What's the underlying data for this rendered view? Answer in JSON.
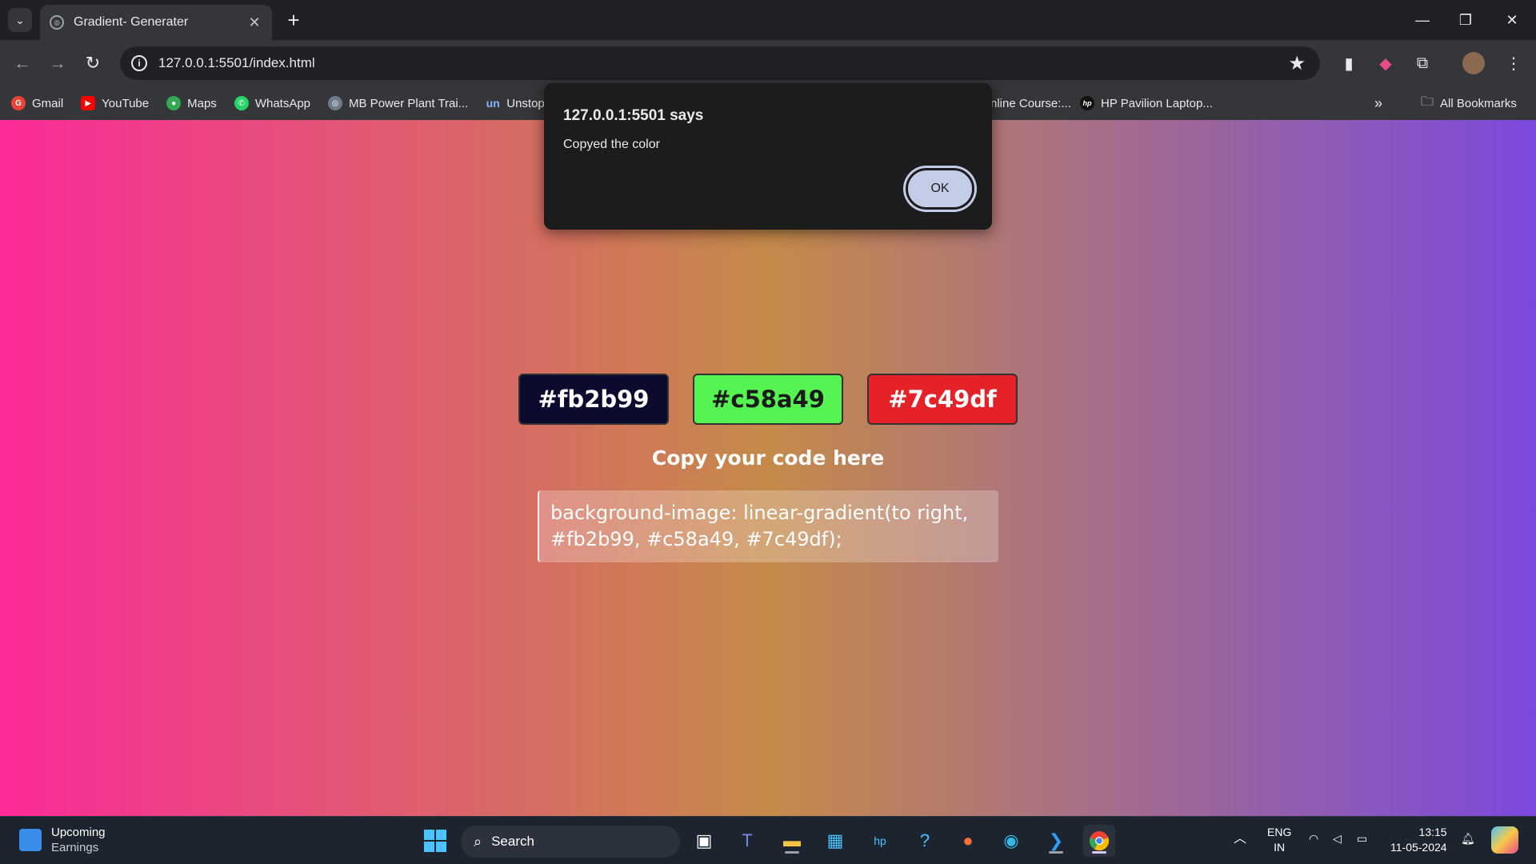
{
  "browser": {
    "tab_title": "Gradient- Generater",
    "url": "127.0.0.1:5501/index.html",
    "bookmarks": [
      {
        "label": "Gmail",
        "color": "#ea4335",
        "glyph": "G"
      },
      {
        "label": "YouTube",
        "color": "#ff0000",
        "glyph": "▶"
      },
      {
        "label": "Maps",
        "color": "#34a853",
        "glyph": "●"
      },
      {
        "label": "WhatsApp",
        "color": "#25d366",
        "glyph": "✆"
      },
      {
        "label": "MB Power Plant Trai...",
        "color": "#8ab4f8",
        "glyph": "◎"
      },
      {
        "label": "Unstop",
        "color": "#1a73e8",
        "glyph": "un"
      }
    ],
    "bookmarks_right": [
      {
        "label": "nline Course:...",
        "color": "#35363a",
        "glyph": ""
      },
      {
        "label": "HP Pavilion Laptop...",
        "color": "#111111",
        "glyph": "hp"
      }
    ],
    "all_bookmarks": "All Bookmarks"
  },
  "dialog": {
    "title": "127.0.0.1:5501 says",
    "message": "Copyed the color",
    "ok_label": "OK"
  },
  "page": {
    "gradient": [
      "#fb2b99",
      "#c58a49",
      "#7c49df"
    ],
    "color_buttons": [
      {
        "label": "#fb2b99",
        "bg": "#0c0a2e",
        "fg": "#ffffff"
      },
      {
        "label": "#c58a49",
        "bg": "#55f352",
        "fg": "#1a1a1a"
      },
      {
        "label": "#7c49df",
        "bg": "#e62229",
        "fg": "#ffffff"
      }
    ],
    "copy_label": "Copy your code here",
    "code_line1": "background-image: linear-gradient(to right,",
    "code_line2": "#fb2b99, #c58a49, #7c49df);"
  },
  "taskbar": {
    "weather_title": "Upcoming",
    "weather_sub": "Earnings",
    "search_label": "Search",
    "lang_top": "ENG",
    "lang_bottom": "IN",
    "time": "13:15",
    "date": "11-05-2024"
  }
}
